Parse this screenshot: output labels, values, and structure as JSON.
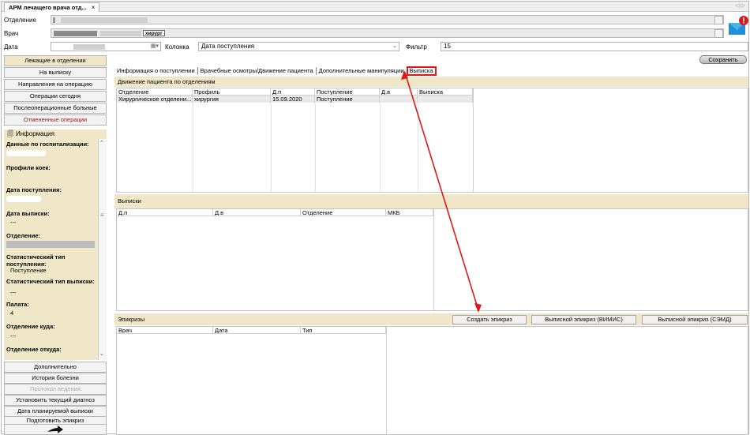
{
  "window": {
    "tab_title": "АРМ лечащего врача отд...",
    "tab_close": "×",
    "nav_arrows": "◁ ▷"
  },
  "header": {
    "dept_label": "Отделение",
    "doctor_label": "Врач",
    "doctor_tag": "хирург",
    "date_label": "Дата",
    "column_label": "Колонка",
    "column_value": "Дата поступления",
    "filter_label": "Фильтр",
    "filter_value": "15"
  },
  "left_nav": {
    "top_buttons": [
      "Лежащие в отделении",
      "На выписку",
      "Направления на операцию",
      "Операции сегодня",
      "Послеоперационные больные",
      "Отмененные операции"
    ],
    "info_title": "Информация",
    "info_fields": [
      {
        "label": "Данные по госпитализации:",
        "value": ""
      },
      {
        "label": "Профили коек:",
        "value": ""
      },
      {
        "label": "Дата поступления:",
        "value": ""
      },
      {
        "label": "Дата выписки:",
        "value": "---"
      },
      {
        "label": "Отделение:",
        "value": ""
      },
      {
        "label": "Статистический тип поступления:",
        "value": "Поступление"
      },
      {
        "label": "Статистический тип выписки:",
        "value": "---"
      },
      {
        "label": "Палата:",
        "value": "4"
      },
      {
        "label": "Отделение куда:",
        "value": "---"
      },
      {
        "label": "Отделение откуда:",
        "value": ""
      }
    ],
    "bottom_buttons": [
      "Дополнительно",
      "История болезни",
      "Протокол ведения",
      "Установить текущий диагноз",
      "Дата планируемой выписки",
      "Подготовить эпикриз"
    ]
  },
  "main": {
    "save_label": "Сохранить",
    "tabs": [
      "Информация о поступлении",
      "Врачебные осмотры/Движение пациента",
      "Дополнительные манипуляции",
      "Выписка"
    ],
    "movement": {
      "title": "Движение пациента по отделениям",
      "columns": [
        "Отделение",
        "Профиль",
        "Д.п",
        "Поступление",
        "Д.в",
        "Выписка"
      ],
      "rows": [
        [
          "Хирургическое отделени...",
          "хирургия",
          "15.09.2020",
          "Поступление",
          "",
          ""
        ]
      ]
    },
    "discharges": {
      "title": "Выписки",
      "columns": [
        "Д.п",
        "Д.в",
        "Отделение",
        "МКБ"
      ]
    },
    "epicrises": {
      "title": "Эпикризы",
      "columns": [
        "Врач",
        "Дата",
        "Тип"
      ],
      "create_label": "Создать эпикриз",
      "vimis_label": "Выписной эпикриз (ВИМИС)",
      "semd_label": "Выписной эпикриз (СЭМД)"
    }
  },
  "colors": {
    "accent_bg": "#efe7c8",
    "highlight_red": "#e01818",
    "cancel_text": "#a3141b"
  }
}
